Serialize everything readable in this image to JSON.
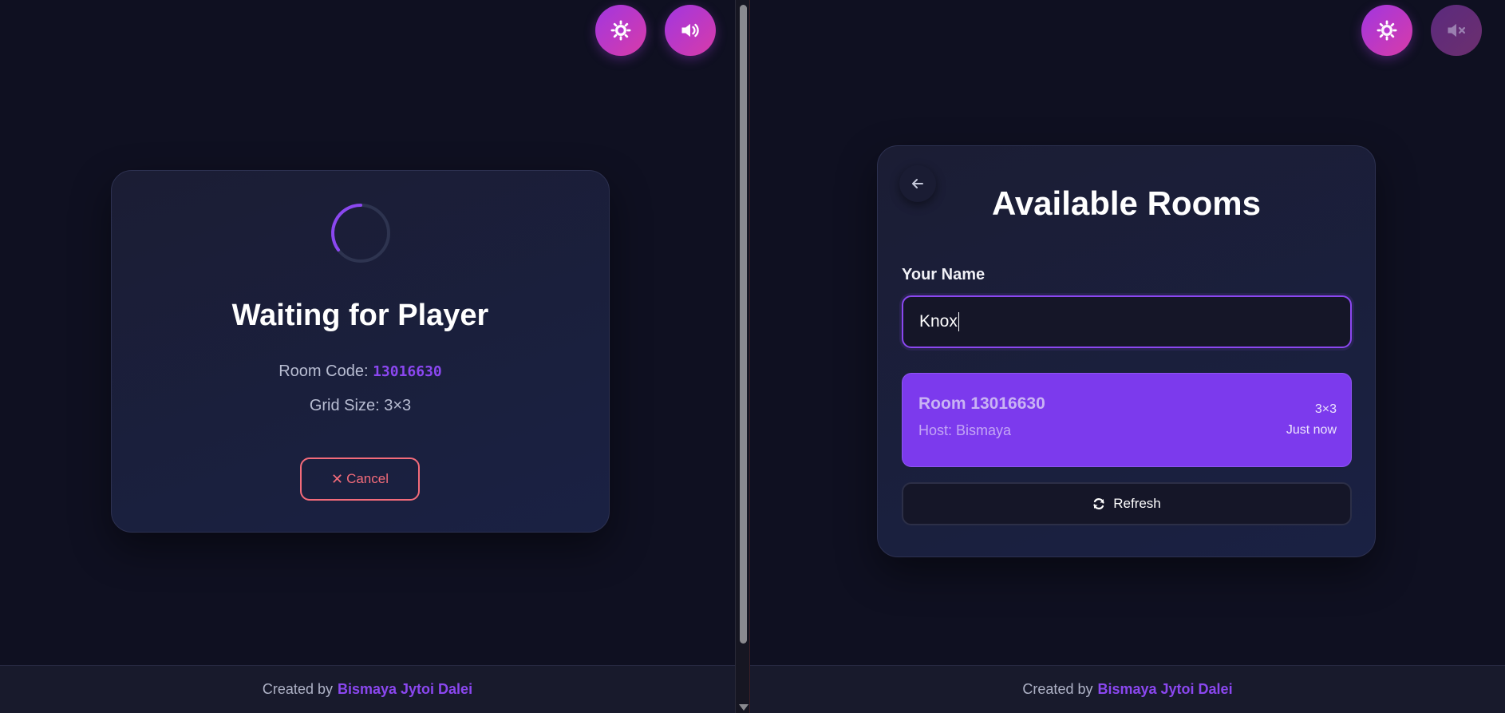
{
  "left_pane": {
    "waiting": {
      "title": "Waiting for Player",
      "room_code_label": "Room Code:",
      "room_code": "13016630",
      "grid_size_text": "Grid Size: 3×3",
      "cancel_label": "Cancel"
    },
    "top_buttons": {
      "theme_icon": "sun-icon",
      "sound_icon": "volume-on-icon"
    }
  },
  "right_pane": {
    "title": "Available Rooms",
    "name_label": "Your Name",
    "name_value": "Knox",
    "rooms": [
      {
        "name": "Room 13016630",
        "host": "Host: Bismaya",
        "grid": "3×3",
        "time": "Just now"
      }
    ],
    "refresh_label": "Refresh",
    "top_buttons": {
      "theme_icon": "sun-icon",
      "sound_icon": "volume-muted-icon"
    }
  },
  "footer": {
    "created_by": "Created by",
    "author": "Bismaya Jytoi Dalei"
  },
  "colors": {
    "background": "#0f1021",
    "accent": "#8b47f0",
    "room_item": "#7c3aed",
    "cancel": "#f36b7a",
    "button_gradient_start": "#a136e0",
    "button_gradient_end": "#d83ba8"
  }
}
